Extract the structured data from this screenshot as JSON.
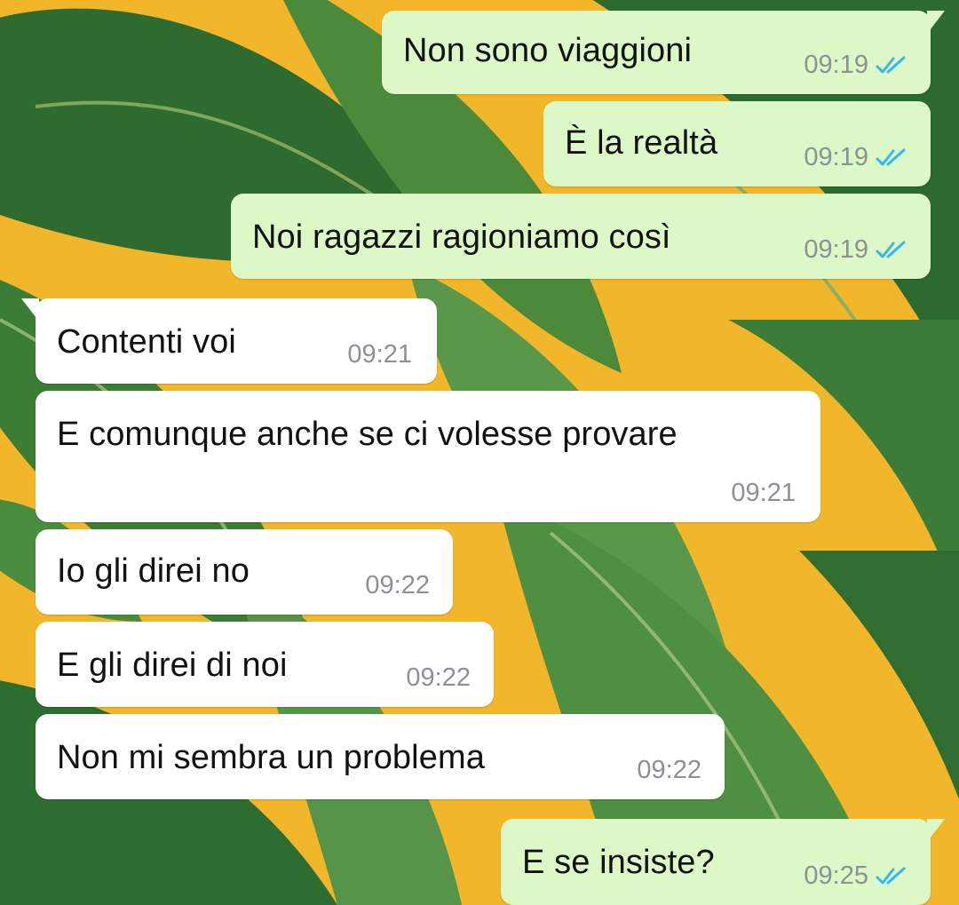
{
  "theme": {
    "outgoing_bubble": "#dcf8c6",
    "incoming_bubble": "#ffffff",
    "read_tick_color": "#34b7f1",
    "wallpaper_leaf_green": "#3f7a36",
    "wallpaper_background_yellow": "#f2b62a"
  },
  "messages": [
    {
      "direction": "outgoing",
      "text": "Non sono viaggioni",
      "time": "09:19",
      "status": "read",
      "status_icon": "double-check-icon"
    },
    {
      "direction": "outgoing",
      "text": "È la realtà",
      "time": "09:19",
      "status": "read",
      "status_icon": "double-check-icon"
    },
    {
      "direction": "outgoing",
      "text": "Noi ragazzi ragioniamo così",
      "time": "09:19",
      "status": "read",
      "status_icon": "double-check-icon"
    },
    {
      "direction": "incoming",
      "text": "Contenti voi",
      "time": "09:21"
    },
    {
      "direction": "incoming",
      "text": "E comunque anche se ci volesse provare",
      "time": "09:21"
    },
    {
      "direction": "incoming",
      "text": "Io gli direi no",
      "time": "09:22"
    },
    {
      "direction": "incoming",
      "text": "E gli direi di noi",
      "time": "09:22"
    },
    {
      "direction": "incoming",
      "text": "Non mi sembra un problema",
      "time": "09:22"
    },
    {
      "direction": "outgoing",
      "text": "E se insiste?",
      "time": "09:25",
      "status": "read",
      "status_icon": "double-check-icon"
    }
  ]
}
